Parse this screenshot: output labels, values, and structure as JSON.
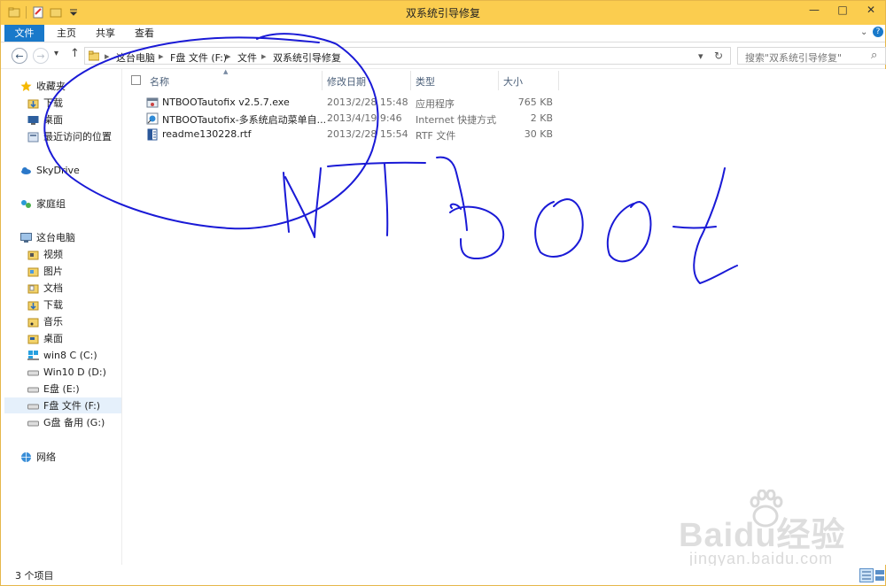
{
  "window": {
    "title": "双系统引导修复",
    "minimize_glyph": "—",
    "maximize_glyph": "□",
    "close_glyph": "✕"
  },
  "ribbon": {
    "tabs": [
      "文件",
      "主页",
      "共享",
      "查看"
    ]
  },
  "address": {
    "back_glyph": "←",
    "forward_glyph": "→",
    "recent_glyph": "▾",
    "up_glyph": "↑",
    "breadcrumbs": [
      "这台电脑",
      "F盘 文件 (F:)",
      "文件",
      "双系统引导修复"
    ],
    "separator": "▸",
    "refresh_glyph": "↻",
    "search_placeholder": "搜索\"双系统引导修复\"",
    "search_glyph": "⌕"
  },
  "nav": {
    "favorites": {
      "label": "收藏夹",
      "items": [
        "下载",
        "桌面",
        "最近访问的位置"
      ]
    },
    "skydrive": "SkyDrive",
    "homegroup": "家庭组",
    "thispc": {
      "label": "这台电脑",
      "items": [
        "视频",
        "图片",
        "文档",
        "下载",
        "音乐",
        "桌面",
        "win8 C (C:)",
        "Win10 D (D:)",
        "E盘 (E:)",
        "F盘 文件 (F:)",
        "G盘 备用 (G:)"
      ]
    },
    "network": "网络"
  },
  "columns": {
    "name": "名称",
    "modified": "修改日期",
    "type": "类型",
    "size": "大小",
    "sort_glyph": "▲"
  },
  "files": [
    {
      "name": "NTBOOTautofix v2.5.7.exe",
      "modified": "2013/2/28 15:48",
      "type": "应用程序",
      "size": "765 KB",
      "icon": "exe-icon"
    },
    {
      "name": "NTBOOTautofix-多系统启动菜单自...",
      "modified": "2013/4/19 9:46",
      "type": "Internet 快捷方式",
      "size": "2 KB",
      "icon": "url-icon"
    },
    {
      "name": "readme130228.rtf",
      "modified": "2013/2/28 15:54",
      "type": "RTF 文件",
      "size": "30 KB",
      "icon": "rtf-icon"
    }
  ],
  "status": {
    "count": "3 个项目"
  },
  "watermark": {
    "brand": "Baidu经验",
    "url": "jingyan.baidu.com"
  },
  "colors": {
    "titlebar": "#fbcd4f",
    "file_tab": "#1979ca",
    "ink": "#1a1ad6"
  }
}
